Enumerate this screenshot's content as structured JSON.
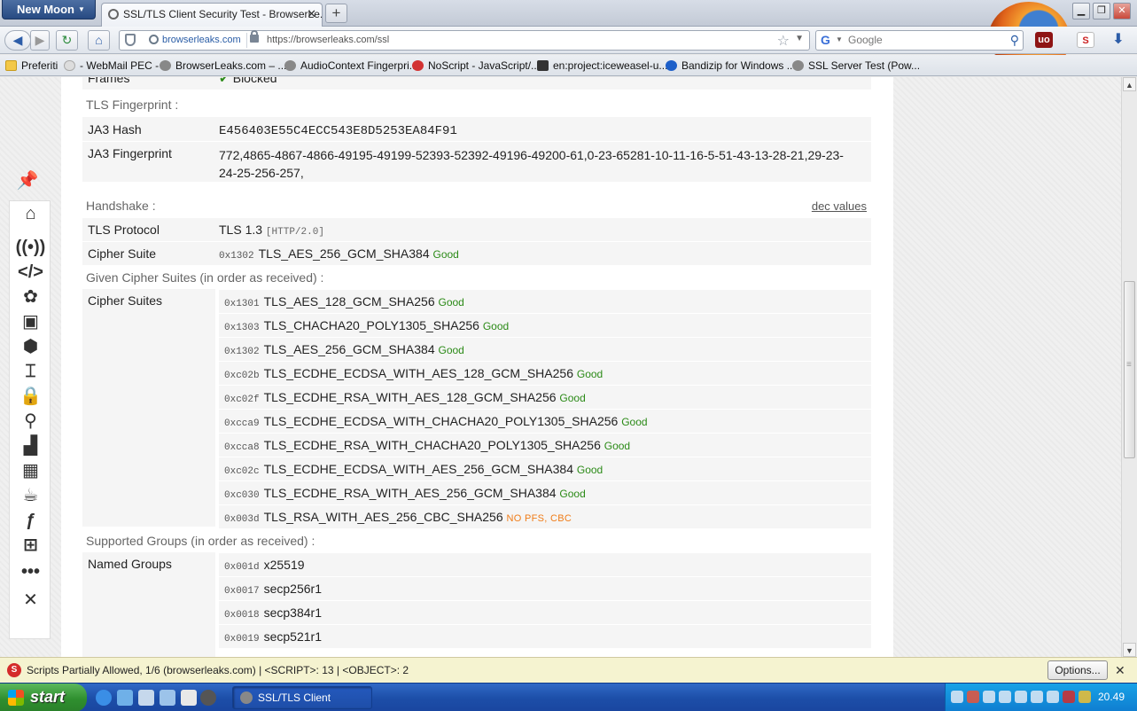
{
  "browser": {
    "app_button": "New Moon",
    "tab_title": "SSL/TLS Client Security Test - BrowserLe...",
    "tab_close": "✕",
    "new_tab": "+",
    "site_identity": "browserleaks.com",
    "url": "https://browserleaks.com/ssl",
    "search_placeholder": "Google"
  },
  "bookmarks": [
    {
      "label": "Preferiti",
      "icon": "folder-icon"
    },
    {
      "label": "- WebMail PEC -",
      "icon": "cloud-icon"
    },
    {
      "label": "BrowserLeaks.com – ...",
      "icon": "fingerprint-icon"
    },
    {
      "label": "AudioContext Fingerpri...",
      "icon": "fingerprint-icon"
    },
    {
      "label": "NoScript - JavaScript/...",
      "icon": "noscript-icon"
    },
    {
      "label": "en:project:iceweasel-u...",
      "icon": "bookmark-icon"
    },
    {
      "label": "Bandizip for Windows ...",
      "icon": "bandizip-icon"
    },
    {
      "label": "SSL Server Test (Pow...",
      "icon": "fingerprint-icon"
    }
  ],
  "page": {
    "frames": {
      "label": "Frames",
      "value": "Blocked"
    },
    "tls_fingerprint": {
      "heading": "TLS Fingerprint :",
      "ja3_hash_label": "JA3 Hash",
      "ja3_hash": "E456403E55C4ECC543E8D5253EA84F91",
      "ja3_fp_label": "JA3 Fingerprint",
      "ja3_fp_line1": "772,4865-4867-4866-49195-49199-52393-52392-49196-49200-61,0-23-65281-10-11-16-5-51-43-13-28-21,29-23-",
      "ja3_fp_line2": "24-25-256-257,"
    },
    "handshake": {
      "heading": "Handshake :",
      "dec_link": "dec values",
      "protocol_label": "TLS Protocol",
      "protocol": "TLS 1.3",
      "protocol_http": "[HTTP/2.0]",
      "cipher_label": "Cipher Suite",
      "cipher_hex": "0x1302",
      "cipher": "TLS_AES_256_GCM_SHA384",
      "cipher_rating": "Good"
    },
    "given_ciphers": {
      "heading": "Given Cipher Suites (in order as received) :",
      "label": "Cipher Suites",
      "items": [
        {
          "hex": "0x1301",
          "name": "TLS_AES_128_GCM_SHA256",
          "rating": "Good"
        },
        {
          "hex": "0x1303",
          "name": "TLS_CHACHA20_POLY1305_SHA256",
          "rating": "Good"
        },
        {
          "hex": "0x1302",
          "name": "TLS_AES_256_GCM_SHA384",
          "rating": "Good"
        },
        {
          "hex": "0xc02b",
          "name": "TLS_ECDHE_ECDSA_WITH_AES_128_GCM_SHA256",
          "rating": "Good"
        },
        {
          "hex": "0xc02f",
          "name": "TLS_ECDHE_RSA_WITH_AES_128_GCM_SHA256",
          "rating": "Good"
        },
        {
          "hex": "0xcca9",
          "name": "TLS_ECDHE_ECDSA_WITH_CHACHA20_POLY1305_SHA256",
          "rating": "Good"
        },
        {
          "hex": "0xcca8",
          "name": "TLS_ECDHE_RSA_WITH_CHACHA20_POLY1305_SHA256",
          "rating": "Good"
        },
        {
          "hex": "0xc02c",
          "name": "TLS_ECDHE_ECDSA_WITH_AES_256_GCM_SHA384",
          "rating": "Good"
        },
        {
          "hex": "0xc030",
          "name": "TLS_ECDHE_RSA_WITH_AES_256_GCM_SHA384",
          "rating": "Good"
        },
        {
          "hex": "0x003d",
          "name": "TLS_RSA_WITH_AES_256_CBC_SHA256",
          "rating": "NO PFS, CBC"
        }
      ]
    },
    "supported_groups": {
      "heading": "Supported Groups (in order as received) :",
      "label": "Named Groups",
      "items": [
        {
          "hex": "0x001d",
          "name": "x25519"
        },
        {
          "hex": "0x0017",
          "name": "secp256r1"
        },
        {
          "hex": "0x0018",
          "name": "secp384r1"
        },
        {
          "hex": "0x0019",
          "name": "secp521r1"
        }
      ]
    }
  },
  "noscript_bar": {
    "message": "Scripts Partially Allowed, 1/6 (browserleaks.com) | <SCRIPT>: 13 | <OBJECT>: 2",
    "options_button": "Options...",
    "close": "✕"
  },
  "taskbar": {
    "start": "start",
    "task_item": "SSL/TLS Client Securit...",
    "clock": "20.49"
  },
  "colors": {
    "good": "#2b8a17",
    "warn": "#f07c18",
    "taskbar": "#1c4ea8",
    "start": "#2f8f2f"
  }
}
